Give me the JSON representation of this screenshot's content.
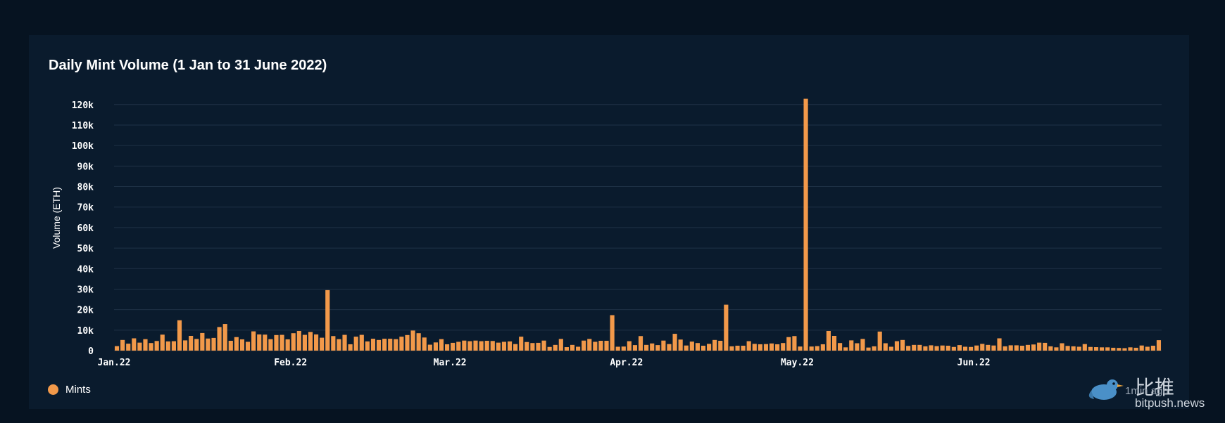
{
  "colors": {
    "background": "#061321",
    "card": "#0a1b2d",
    "bar": "#f2994a",
    "grid": "#1f3246",
    "text": "#ffffff"
  },
  "legend": {
    "label": "Mints",
    "icon": "circle-dot-icon"
  },
  "watermark": {
    "cn": "比推",
    "url": "bitpush.news",
    "sub": "1min ago",
    "icon": "bird-icon"
  },
  "chart_data": {
    "type": "bar",
    "title": "Daily Mint Volume (1 Jan to 31 June 2022)",
    "xlabel": "",
    "ylabel": "Volume (ETH)",
    "ylim": [
      0,
      120000
    ],
    "yticks": [
      "0",
      "10k",
      "20k",
      "30k",
      "40k",
      "50k",
      "60k",
      "70k",
      "80k",
      "90k",
      "100k",
      "110k",
      "120k"
    ],
    "xtick_labels": [
      {
        "label": "Jan.22",
        "index": 0
      },
      {
        "label": "Feb.22",
        "index": 31
      },
      {
        "label": "Mar.22",
        "index": 59
      },
      {
        "label": "Apr.22",
        "index": 90
      },
      {
        "label": "May.22",
        "index": 120
      },
      {
        "label": "Jun.22",
        "index": 151
      }
    ],
    "grid": true,
    "legend_position": "bottom-left",
    "series": [
      {
        "name": "Mints",
        "start_date": "2022-01-01",
        "values": [
          2200,
          5200,
          3400,
          6000,
          3900,
          5600,
          3700,
          4700,
          7800,
          4500,
          4600,
          14800,
          5000,
          7200,
          5700,
          8600,
          5900,
          6200,
          11500,
          13000,
          4800,
          6600,
          5500,
          4300,
          9400,
          7900,
          7800,
          5600,
          7600,
          7700,
          5500,
          8500,
          9600,
          7700,
          9100,
          7900,
          6300,
          29500,
          7100,
          5600,
          7700,
          3100,
          6800,
          7700,
          4500,
          5800,
          5200,
          5800,
          5800,
          5600,
          6800,
          7600,
          9800,
          8500,
          6400,
          2900,
          4000,
          5600,
          3100,
          3800,
          4300,
          4900,
          4600,
          4900,
          4600,
          4800,
          4700,
          3900,
          4300,
          4500,
          3200,
          6800,
          4200,
          3700,
          3800,
          4900,
          1800,
          2800,
          5700,
          1700,
          2800,
          1900,
          4900,
          5700,
          4300,
          4800,
          4800,
          17300,
          1900,
          2000,
          4600,
          2700,
          7100,
          2800,
          3500,
          2700,
          4900,
          3200,
          8200,
          5400,
          2500,
          4400,
          3700,
          2400,
          3300,
          5200,
          4800,
          22400,
          2100,
          2400,
          2400,
          4600,
          3300,
          3100,
          3200,
          3500,
          3100,
          3700,
          6600,
          7100,
          2000,
          122800,
          2000,
          2200,
          3100,
          9600,
          7200,
          3700,
          1600,
          5000,
          3600,
          5700,
          1500,
          2100,
          9300,
          3600,
          1900,
          4600,
          5200,
          2300,
          2800,
          2800,
          2100,
          2600,
          2200,
          2500,
          2400,
          1800,
          2700,
          1900,
          1800,
          2500,
          3300,
          2800,
          2500,
          6000,
          2100,
          2600,
          2600,
          2400,
          2800,
          3000,
          3900,
          3800,
          2100,
          1600,
          3600,
          2300,
          2100,
          1900,
          3200,
          1800,
          1700,
          1600,
          1600,
          1400,
          1300,
          1200,
          1600,
          1400,
          2500,
          1900,
          2400,
          5100
        ]
      }
    ]
  }
}
